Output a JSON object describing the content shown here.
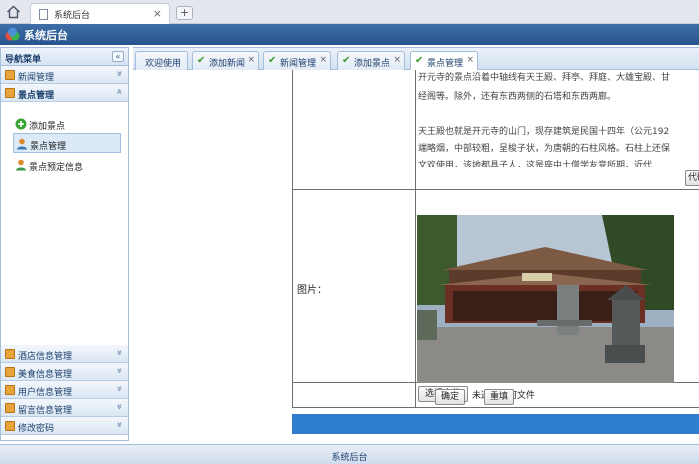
{
  "browser": {
    "tab_title": "系统后台",
    "close_glyph": "×",
    "new_tab_glyph": "+"
  },
  "app": {
    "title": "系统后台",
    "footer": "系统后台"
  },
  "sidebar": {
    "title": "导航菜单",
    "collapse_glyph": "«",
    "groups_top": [
      {
        "label": "新闻管理",
        "chevron": "»"
      },
      {
        "label": "景点管理",
        "chevron": "«"
      }
    ],
    "items": [
      {
        "label": "添加景点",
        "icon": "add-icon"
      },
      {
        "label": "景点管理",
        "icon": "user-icon"
      },
      {
        "label": "景点预定信息",
        "icon": "user-icon"
      }
    ],
    "groups_bottom": [
      {
        "label": "酒店信息管理",
        "chevron": "»"
      },
      {
        "label": "美食信息管理",
        "chevron": "»"
      },
      {
        "label": "用户信息管理",
        "chevron": "»"
      },
      {
        "label": "留言信息管理",
        "chevron": "»"
      },
      {
        "label": "修改密码",
        "chevron": "»"
      }
    ]
  },
  "tabs": [
    {
      "label": "欢迎使用",
      "closable": false,
      "checked": false
    },
    {
      "label": "添加新闻",
      "closable": true,
      "checked": true
    },
    {
      "label": "新闻管理",
      "closable": true,
      "checked": false
    },
    {
      "label": "添加景点",
      "closable": true,
      "checked": true
    },
    {
      "label": "景点管理",
      "closable": true,
      "checked": true,
      "active": true
    }
  ],
  "tab_close_glyph": "×",
  "tab_check_glyph": "✔",
  "form": {
    "paragraph_lines": [
      "开元寺的景点沿着中轴线有天王殿、拜亭、拜庭、大雄宝殿、甘",
      "经阁等。除外，还有东西两侧的石塔和东西两廊。",
      "天王殿也就是开元寺的山门，现存建筑是民国十四年（公元192",
      "端略烟，中部较粗，呈梭子状，为唐朝的石柱风格。石柱上还保",
      "文欢使用，该地都具子人，这是座中土僧学友竞所期，近代"
    ],
    "code_button": "代码",
    "image_label": "图片：",
    "file_button": "选择文件",
    "file_status": "未选择任何文件",
    "confirm": "确定",
    "reset": "重填"
  }
}
